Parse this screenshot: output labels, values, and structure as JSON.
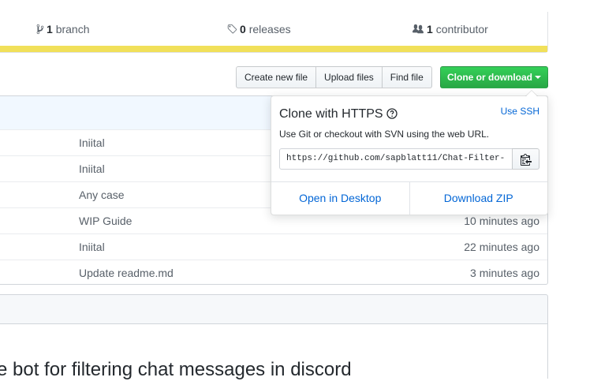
{
  "summary": {
    "branches_count": "1",
    "branches_label": "branch",
    "releases_count": "0",
    "releases_label": "releases",
    "contributors_count": "1",
    "contributors_label": "contributor",
    "language_bar_color": "#f1e05a"
  },
  "toolbar": {
    "create_new_file": "Create new file",
    "upload_files": "Upload files",
    "find_file": "Find file",
    "clone_or_download": "Clone or download"
  },
  "files": {
    "rows": [
      {
        "message": "Iniital",
        "age": ""
      },
      {
        "message": "Iniital",
        "age": ""
      },
      {
        "message": "Any case",
        "age": ""
      },
      {
        "message": "WIP Guide",
        "age": "10 minutes ago"
      },
      {
        "message": "Iniital",
        "age": "22 minutes ago"
      },
      {
        "message": "Update readme.md",
        "age": "3 minutes ago"
      }
    ]
  },
  "readme": {
    "heading": "e bot for filtering chat messages in discord"
  },
  "clone_popover": {
    "title": "Clone with HTTPS",
    "use_ssh": "Use SSH",
    "description": "Use Git or checkout with SVN using the web URL.",
    "url": "https://github.com/sapblatt11/Chat-Filter-",
    "open_in_desktop": "Open in Desktop",
    "download_zip": "Download ZIP"
  },
  "colors": {
    "primary_green": "#28a745",
    "link_blue": "#0366d6"
  }
}
